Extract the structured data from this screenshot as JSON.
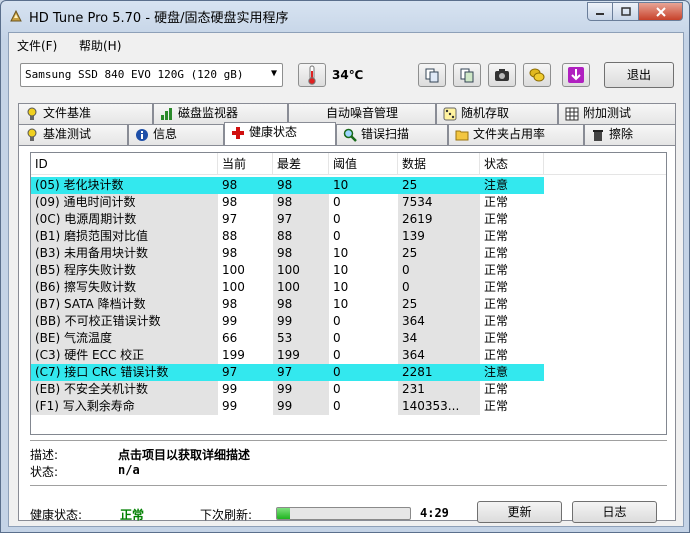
{
  "window": {
    "title": "HD Tune Pro 5.70 - 硬盘/固态硬盘实用程序"
  },
  "menu": {
    "file": "文件(F)",
    "help": "帮助(H)"
  },
  "toolbar": {
    "drive": "Samsung SSD 840 EVO 120G (120 gB)",
    "temperature": "34℃",
    "exit": "退出"
  },
  "tabs_top": [
    "文件基准",
    "磁盘监视器",
    "自动噪音管理",
    "随机存取",
    "附加测试"
  ],
  "tabs_bottom": [
    "基准测试",
    "信息",
    "健康状态",
    "错误扫描",
    "文件夹占用率",
    "擦除"
  ],
  "active_tab": "健康状态",
  "table": {
    "headers": [
      "ID",
      "当前",
      "最差",
      "阈值",
      "数据",
      "状态"
    ],
    "rows": [
      {
        "id": "(05) 老化块计数",
        "cur": "98",
        "worst": "98",
        "thr": "10",
        "data": "25",
        "status": "注意",
        "warn": true
      },
      {
        "id": "(09) 通电时间计数",
        "cur": "98",
        "worst": "98",
        "thr": "0",
        "data": "7534",
        "status": "正常"
      },
      {
        "id": "(0C) 电源周期计数",
        "cur": "97",
        "worst": "97",
        "thr": "0",
        "data": "2619",
        "status": "正常"
      },
      {
        "id": "(B1) 磨损范围对比值",
        "cur": "88",
        "worst": "88",
        "thr": "0",
        "data": "139",
        "status": "正常"
      },
      {
        "id": "(B3) 未用备用块计数",
        "cur": "98",
        "worst": "98",
        "thr": "10",
        "data": "25",
        "status": "正常"
      },
      {
        "id": "(B5) 程序失败计数",
        "cur": "100",
        "worst": "100",
        "thr": "10",
        "data": "0",
        "status": "正常"
      },
      {
        "id": "(B6) 擦写失败计数",
        "cur": "100",
        "worst": "100",
        "thr": "10",
        "data": "0",
        "status": "正常"
      },
      {
        "id": "(B7) SATA 降档计数",
        "cur": "98",
        "worst": "98",
        "thr": "10",
        "data": "25",
        "status": "正常"
      },
      {
        "id": "(BB) 不可校正错误计数",
        "cur": "99",
        "worst": "99",
        "thr": "0",
        "data": "364",
        "status": "正常"
      },
      {
        "id": "(BE) 气流温度",
        "cur": "66",
        "worst": "53",
        "thr": "0",
        "data": "34",
        "status": "正常"
      },
      {
        "id": "(C3) 硬件 ECC 校正",
        "cur": "199",
        "worst": "199",
        "thr": "0",
        "data": "364",
        "status": "正常"
      },
      {
        "id": "(C7) 接口 CRC 错误计数",
        "cur": "97",
        "worst": "97",
        "thr": "0",
        "data": "2281",
        "status": "注意",
        "warn": true
      },
      {
        "id": "(EB) 不安全关机计数",
        "cur": "99",
        "worst": "99",
        "thr": "0",
        "data": "231",
        "status": "正常"
      },
      {
        "id": "(F1) 写入剩余寿命",
        "cur": "99",
        "worst": "99",
        "thr": "0",
        "data": "140353...",
        "status": "正常"
      }
    ]
  },
  "details": {
    "desc_label": "描述:",
    "desc_value": "点击项目以获取详细描述",
    "status_label": "状态:",
    "status_value": "n/a"
  },
  "footer": {
    "health_label": "健康状态:",
    "health_value": "正常",
    "health_color": "#008000",
    "refresh_label": "下次刷新:",
    "refresh_progress": 0.1,
    "refresh_time": "4:29",
    "update_button": "更新",
    "log_button": "日志"
  }
}
